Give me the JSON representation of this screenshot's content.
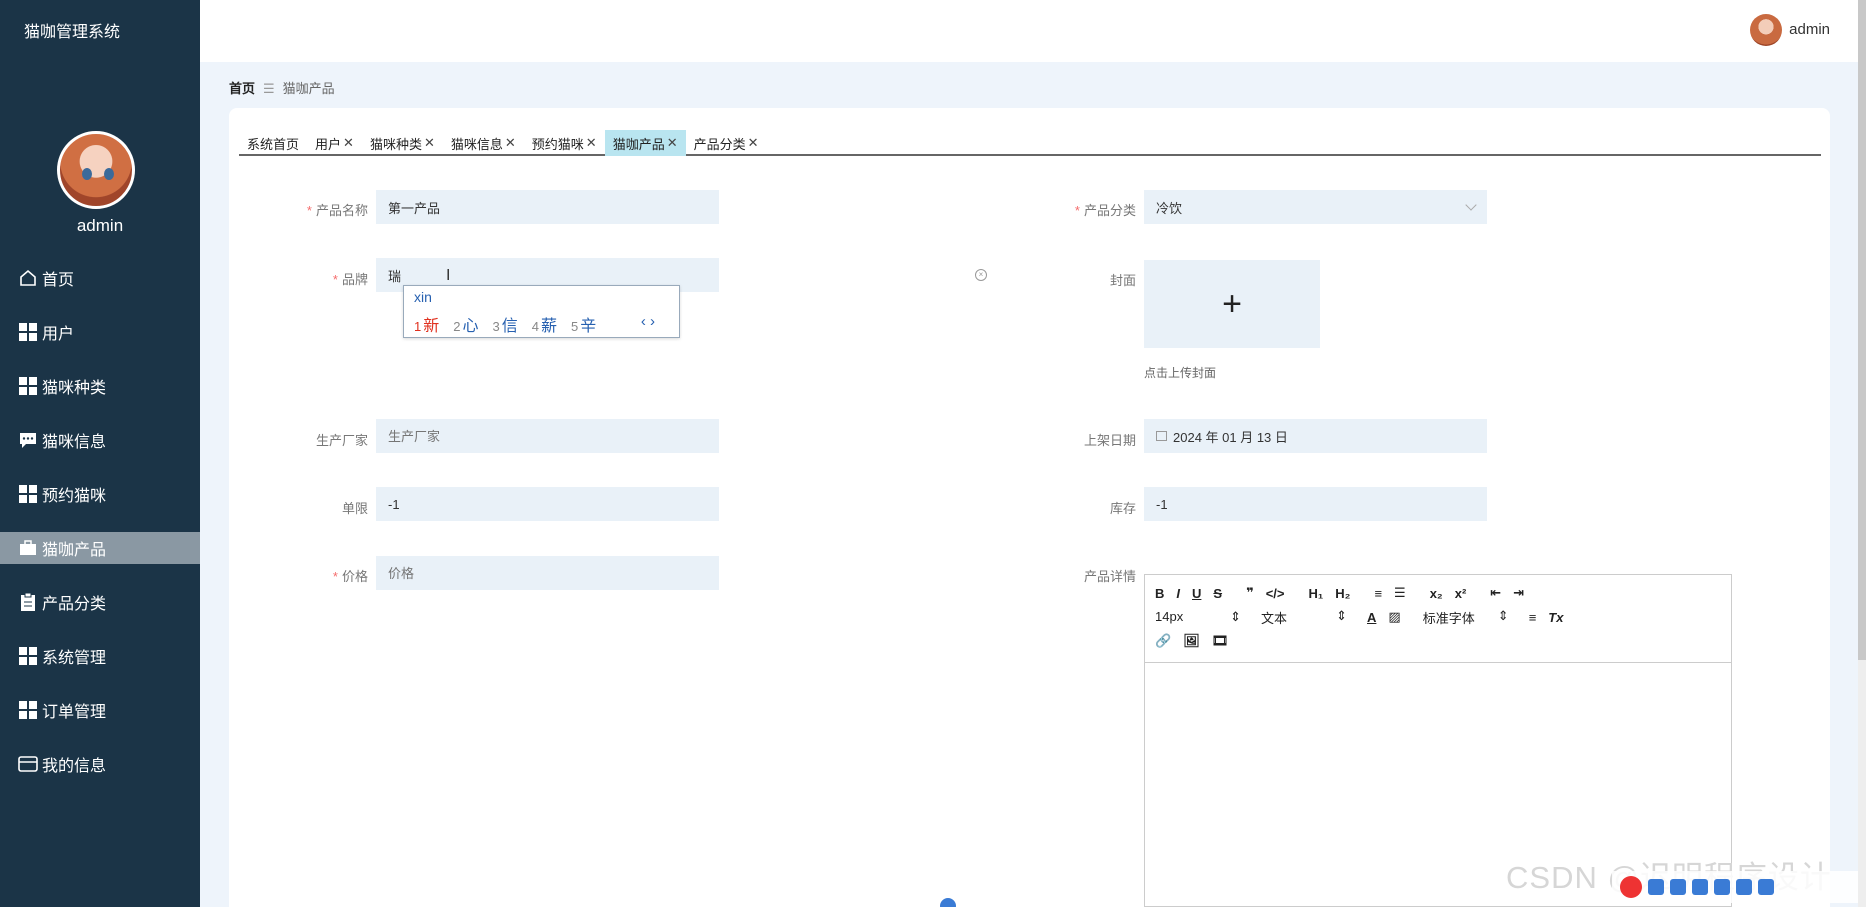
{
  "app": {
    "title": "猫咖管理系统"
  },
  "sidebar": {
    "user": "admin",
    "items": [
      {
        "label": "首页",
        "icon": "home-icon"
      },
      {
        "label": "用户",
        "icon": "grid-icon"
      },
      {
        "label": "猫咪种类",
        "icon": "grid-icon"
      },
      {
        "label": "猫咪信息",
        "icon": "chat-icon"
      },
      {
        "label": "预约猫咪",
        "icon": "grid-icon"
      },
      {
        "label": "猫咖产品",
        "icon": "briefcase-icon",
        "active": true
      },
      {
        "label": "产品分类",
        "icon": "clipboard-icon"
      },
      {
        "label": "系统管理",
        "icon": "grid-icon"
      },
      {
        "label": "订单管理",
        "icon": "grid-icon"
      },
      {
        "label": "我的信息",
        "icon": "wallet-icon"
      }
    ]
  },
  "topbar": {
    "user": "admin"
  },
  "breadcrumb": {
    "home": "首页",
    "sep": "☰",
    "current": "猫咖产品"
  },
  "tabs": [
    {
      "label": "系统首页",
      "closable": false
    },
    {
      "label": "用户",
      "closable": true
    },
    {
      "label": "猫咪种类",
      "closable": true
    },
    {
      "label": "猫咪信息",
      "closable": true
    },
    {
      "label": "预约猫咪",
      "closable": true
    },
    {
      "label": "猫咖产品",
      "closable": true,
      "active": true
    },
    {
      "label": "产品分类",
      "closable": true
    }
  ],
  "form": {
    "name": {
      "label": "产品名称",
      "value": "第一产品",
      "required": true
    },
    "category": {
      "label": "产品分类",
      "value": "冷饮",
      "required": true
    },
    "brand": {
      "label": "品牌",
      "value": "瑞",
      "required": true
    },
    "cover": {
      "label": "封面",
      "tip": "点击上传封面"
    },
    "maker": {
      "label": "生产厂家",
      "placeholder": "生产厂家"
    },
    "date": {
      "label": "上架日期",
      "value": "2024 年 01 月 13 日"
    },
    "limit": {
      "label": "单限",
      "value": "-1"
    },
    "stock": {
      "label": "库存",
      "value": "-1"
    },
    "price": {
      "label": "价格",
      "placeholder": "价格",
      "required": true
    },
    "detail": {
      "label": "产品详情"
    }
  },
  "ime": {
    "pinyin": "xin",
    "candidates": [
      {
        "n": "1",
        "c": "新"
      },
      {
        "n": "2",
        "c": "心"
      },
      {
        "n": "3",
        "c": "信"
      },
      {
        "n": "4",
        "c": "薪"
      },
      {
        "n": "5",
        "c": "辛"
      }
    ],
    "nav": "‹ ›"
  },
  "editor": {
    "font_size": "14px",
    "block": "文本",
    "font_family": "标准字体",
    "buttons_row1": [
      "B",
      "I",
      "U",
      "S",
      "❞",
      "</>",
      "H₁",
      "H₂",
      "≡",
      "☰",
      "x₂",
      "x²",
      "⇤",
      "⇥"
    ],
    "buttons_row3": [
      "🔗",
      "🖼",
      "🎞"
    ]
  },
  "watermark": "CSDN @迟明程序设计"
}
